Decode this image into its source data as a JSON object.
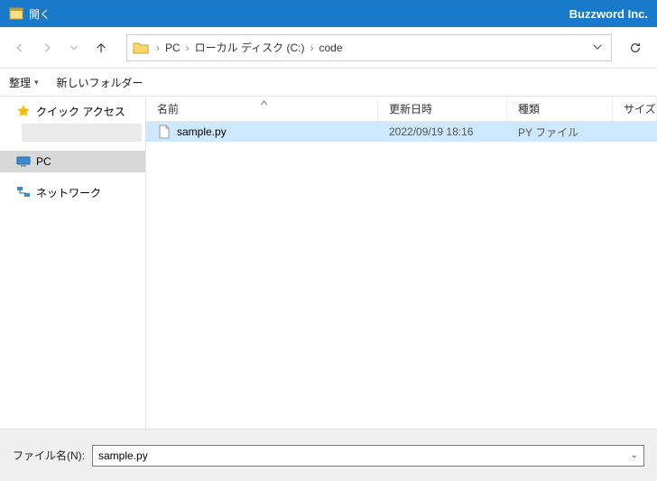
{
  "titlebar": {
    "title": "開く",
    "brand": "Buzzword Inc."
  },
  "breadcrumb": {
    "seg1": "PC",
    "seg2": "ローカル ディスク (C:)",
    "seg3": "code"
  },
  "toolbar": {
    "organize": "整理",
    "newfolder": "新しいフォルダー"
  },
  "sidebar": {
    "quick": "クイック アクセス",
    "pc": "PC",
    "network": "ネットワーク"
  },
  "columns": {
    "name": "名前",
    "date": "更新日時",
    "type": "種類",
    "size": "サイズ"
  },
  "files": [
    {
      "name": "sample.py",
      "date": "2022/09/19 18:16",
      "type": "PY ファイル"
    }
  ],
  "footer": {
    "label": "ファイル名(N):",
    "value": "sample.py"
  }
}
